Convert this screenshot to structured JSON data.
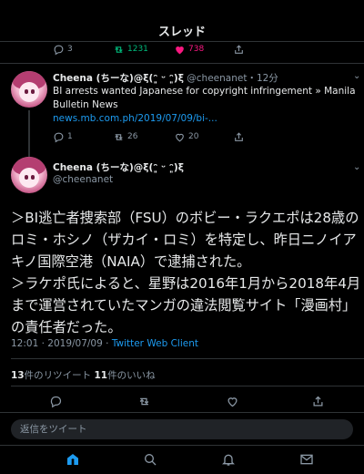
{
  "header": {
    "title": "スレッド"
  },
  "top_actions": {
    "reply_count": "3",
    "retweet_count": "1231",
    "like_count": "738"
  },
  "reply_tweet": {
    "name": "Cheena (ちーな)@ξ(ᵔ͈ ᵕ ᵔ͈)ξ",
    "handle": "@cheenanet",
    "time": "12分",
    "text_line1": "BI arrests wanted Japanese for copyright infringement » Manila",
    "text_line2": "Bulletin News",
    "link": "news.mb.com.ph/2019/07/09/bi-...",
    "reply_count": "1",
    "retweet_count": "26",
    "like_count": "20"
  },
  "main_tweet": {
    "name": "Cheena (ちーな)@ξ(ᵔ͈ ᵕ ᵔ͈)ξ",
    "handle": "@cheenanet",
    "lines": [
      "＞BI逃亡者捜索部（FSU）のボビー・ラクエポは28歳の",
      "ロミ・ホシノ（ザカイ・ロミ）を特定し、昨日ニノイア",
      "キノ国際空港（NAIA）で逮捕された。",
      "＞ラケポ氏によると、星野は2016年1月から2018年4月",
      "まで運営されていたマンガの違法閲覧サイト「漫画村」",
      "の責任者だった。"
    ],
    "timestamp": "12:01 · 2019/07/09 · ",
    "client": "Twitter Web Client",
    "retweets_num": "13",
    "retweets_label": "件のリツイート",
    "likes_num": "11",
    "likes_label": "件のいいね"
  },
  "reply_box": {
    "placeholder": "返信をツイート"
  },
  "colors": {
    "accent": "#1d9bf0",
    "retweet": "#00ba7c",
    "like": "#f91880",
    "muted": "#8b98a5"
  },
  "tabs": [
    "home-icon",
    "search-icon",
    "bell-icon",
    "mail-icon"
  ]
}
